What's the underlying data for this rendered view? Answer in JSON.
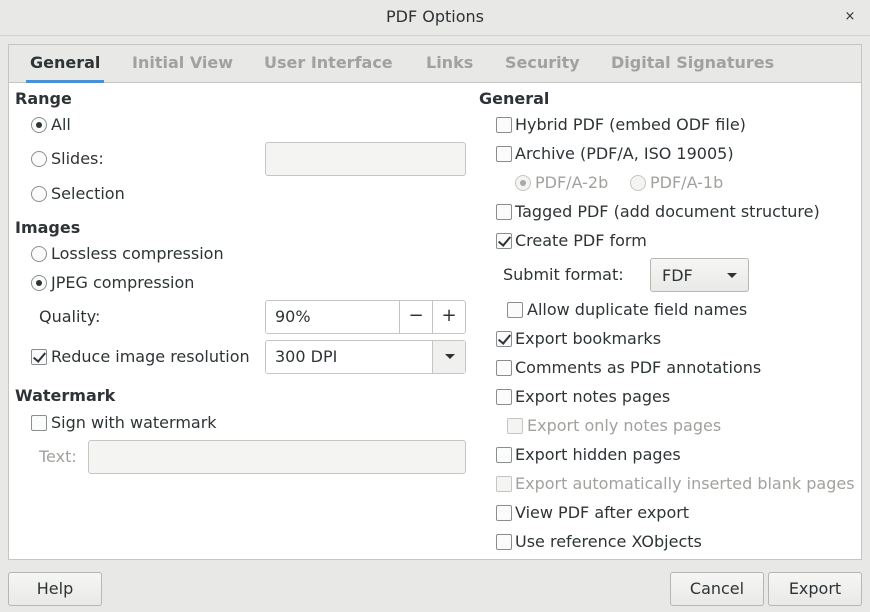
{
  "window": {
    "title": "PDF Options",
    "close_glyph": "×"
  },
  "tabs": [
    {
      "label": "General",
      "active": true
    },
    {
      "label": "Initial View"
    },
    {
      "label": "User Interface"
    },
    {
      "label": "Links"
    },
    {
      "label": "Security"
    },
    {
      "label": "Digital Signatures"
    }
  ],
  "range": {
    "heading": "Range",
    "all": "All",
    "slides": "Slides:",
    "selection": "Selection",
    "slides_value": ""
  },
  "images": {
    "heading": "Images",
    "lossless": "Lossless compression",
    "jpeg": "JPEG compression",
    "quality_label": "Quality:",
    "quality_value": "90%",
    "minus": "−",
    "plus": "+",
    "reduce_label": "Reduce image resolution",
    "resolution_value": "300 DPI"
  },
  "watermark": {
    "heading": "Watermark",
    "sign": "Sign with watermark",
    "text_label": "Text:",
    "text_value": ""
  },
  "general": {
    "heading": "General",
    "hybrid": "Hybrid PDF (embed ODF file)",
    "archive": "Archive (PDF/A, ISO 19005)",
    "pdfa2b": "PDF/A-2b",
    "pdfa1b": "PDF/A-1b",
    "tagged": "Tagged PDF (add document structure)",
    "create_form": "Create PDF form",
    "submit_label": "Submit format:",
    "submit_value": "FDF",
    "allow_dup": "Allow duplicate field names",
    "bookmarks": "Export bookmarks",
    "comments": "Comments as PDF annotations",
    "notes": "Export notes pages",
    "only_notes": "Export only notes pages",
    "hidden": "Export hidden pages",
    "blank": "Export automatically inserted blank pages",
    "view_after": "View PDF after export",
    "xobjects": "Use reference XObjects"
  },
  "footer": {
    "help": "Help",
    "cancel": "Cancel",
    "export": "Export"
  }
}
